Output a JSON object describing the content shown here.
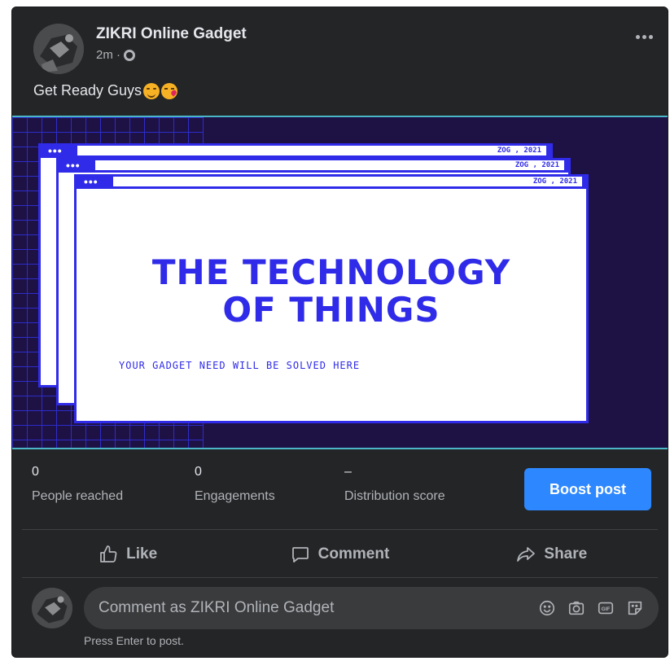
{
  "post": {
    "author": "ZIKRI Online Gadget",
    "time": "2m ·",
    "caption": "Get Ready Guys",
    "caption_emojis": [
      "smiling-face-emoji",
      "face-blowing-kiss-emoji"
    ]
  },
  "image": {
    "window_tag": "ZOG , 2021",
    "window_dots": "•••",
    "headline_line1": "THE TECHNOLOGY",
    "headline_line2": "OF THINGS",
    "subline": "YOUR GADGET NEED WILL BE SOLVED HERE",
    "colors": {
      "background": "#1e1244",
      "accent": "#2f2be8",
      "grid": "#2f2fd9"
    }
  },
  "stats": [
    {
      "value": "0",
      "label": "People reached"
    },
    {
      "value": "0",
      "label": "Engagements"
    },
    {
      "value": "–",
      "label": "Distribution score"
    }
  ],
  "boost_label": "Boost post",
  "actions": {
    "like": "Like",
    "comment": "Comment",
    "share": "Share"
  },
  "comment": {
    "placeholder": "Comment as ZIKRI Online Gadget",
    "hint": "Press Enter to post.",
    "icons": [
      "emoji-icon",
      "camera-icon",
      "gif-icon",
      "sticker-icon"
    ]
  },
  "theme": {
    "card": "#242526",
    "text": "#e4e6eb",
    "muted": "#b0b3b8",
    "primary": "#2d88ff"
  }
}
